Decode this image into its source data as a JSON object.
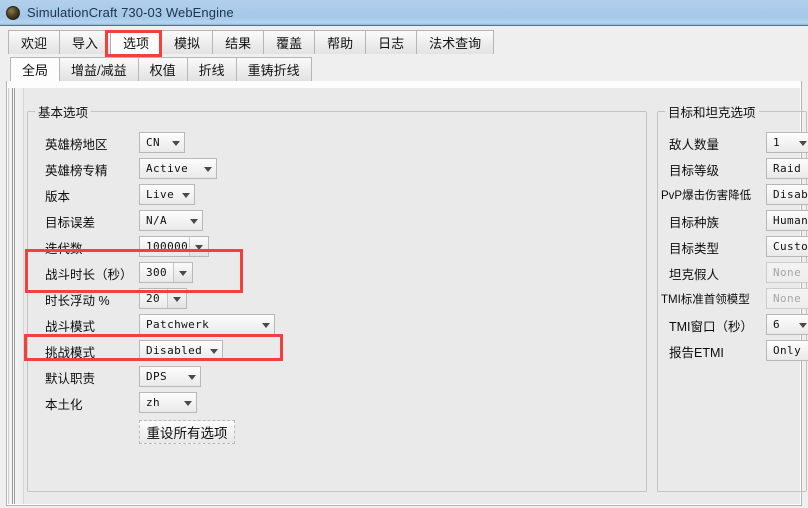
{
  "window": {
    "title": "SimulationCraft 730-03 WebEngine",
    "icon": "app-logo-icon"
  },
  "main_tabs": [
    {
      "label": "欢迎",
      "selected": false
    },
    {
      "label": "导入",
      "selected": false
    },
    {
      "label": "选项",
      "selected": true
    },
    {
      "label": "模拟",
      "selected": false
    },
    {
      "label": "结果",
      "selected": false
    },
    {
      "label": "覆盖",
      "selected": false
    },
    {
      "label": "帮助",
      "selected": false
    },
    {
      "label": "日志",
      "selected": false
    },
    {
      "label": "法术查询",
      "selected": false
    }
  ],
  "sub_tabs": [
    {
      "label": "全局",
      "selected": true
    },
    {
      "label": "增益/减益",
      "selected": false
    },
    {
      "label": "权值",
      "selected": false
    },
    {
      "label": "折线",
      "selected": false
    },
    {
      "label": "重铸折线",
      "selected": false
    }
  ],
  "basic_options": {
    "title": "基本选项",
    "rows": [
      {
        "label": "英雄榜地区",
        "value": "CN",
        "disabled": false,
        "split": false
      },
      {
        "label": "英雄榜专精",
        "value": "Active",
        "disabled": false,
        "split": false
      },
      {
        "label": "版本",
        "value": "Live",
        "disabled": false,
        "split": false
      },
      {
        "label": "目标误差",
        "value": "N/A",
        "disabled": false,
        "split": false
      },
      {
        "label": "迭代数",
        "value": "100000",
        "disabled": false,
        "split": true
      },
      {
        "label": "战斗时长（秒）",
        "value": "300",
        "disabled": false,
        "split": true
      },
      {
        "label": "时长浮动 %",
        "value": "20",
        "disabled": false,
        "split": true
      },
      {
        "label": "战斗模式",
        "value": "Patchwerk",
        "disabled": false,
        "split": false
      },
      {
        "label": "挑战模式",
        "value": "Disabled",
        "disabled": false,
        "split": false
      },
      {
        "label": "默认职责",
        "value": "DPS",
        "disabled": false,
        "split": false
      },
      {
        "label": "本土化",
        "value": "zh",
        "disabled": false,
        "split": false
      }
    ],
    "reset_button": "重设所有选项"
  },
  "target_options": {
    "title": "目标和坦克选项",
    "rows": [
      {
        "label": "敌人数量",
        "value": "1",
        "disabled": false
      },
      {
        "label": "目标等级",
        "value": "Raid Bos",
        "disabled": false
      },
      {
        "label": "PvP爆击伤害降低",
        "value": "Disable",
        "disabled": false
      },
      {
        "label": "目标种族",
        "value": "Humanoi",
        "disabled": false
      },
      {
        "label": "目标类型",
        "value": "Custom",
        "disabled": false
      },
      {
        "label": "坦克假人",
        "value": "None",
        "disabled": true
      },
      {
        "label": "TMI标准首领模型",
        "value": "None",
        "disabled": true
      },
      {
        "label": "TMI窗口（秒）",
        "value": "6",
        "disabled": false
      },
      {
        "label": "报告ETMI",
        "value": "Only whe",
        "disabled": false
      }
    ]
  },
  "annotations": {
    "accent_color": "#f2403c",
    "boxes": [
      {
        "name": "highlight-options-tab"
      },
      {
        "name": "highlight-iterations-and-fightlength"
      },
      {
        "name": "highlight-fight-style"
      }
    ]
  }
}
